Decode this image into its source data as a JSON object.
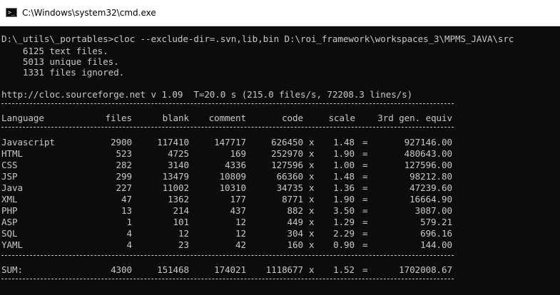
{
  "window": {
    "title": "C:\\Windows\\system32\\cmd.exe",
    "icon": "cmd-prompt-icon",
    "icon_glyph": ">_"
  },
  "console": {
    "command": "D:\\_utils\\_portables>cloc --exclude-dir=.svn,lib,bin D:\\roi_framework\\workspaces_3\\MPMS_JAVA\\src",
    "summary": [
      "    6125 text files.",
      "    5013 unique files.",
      "    1331 files ignored."
    ],
    "header_info": "http://cloc.sourceforge.net v 1.09  T=20.0 s (215.0 files/s, 72208.3 lines/s)",
    "columns": [
      "Language",
      "files",
      "blank",
      "comment",
      "code",
      "scale",
      "3rd gen. equiv"
    ],
    "rows": [
      {
        "language": "Javascript",
        "files": "2900",
        "blank": "117410",
        "comment": "147717",
        "code": "626450",
        "x": "x",
        "scale": "1.48",
        "eq": "=",
        "equiv": "927146.00"
      },
      {
        "language": "HTML",
        "files": "523",
        "blank": "4725",
        "comment": "169",
        "code": "252970",
        "x": "x",
        "scale": "1.90",
        "eq": "=",
        "equiv": "480643.00"
      },
      {
        "language": "CSS",
        "files": "282",
        "blank": "3140",
        "comment": "4336",
        "code": "127596",
        "x": "x",
        "scale": "1.00",
        "eq": "=",
        "equiv": "127596.00"
      },
      {
        "language": "JSP",
        "files": "299",
        "blank": "13479",
        "comment": "10809",
        "code": "66360",
        "x": "x",
        "scale": "1.48",
        "eq": "=",
        "equiv": "98212.80"
      },
      {
        "language": "Java",
        "files": "227",
        "blank": "11002",
        "comment": "10310",
        "code": "34735",
        "x": "x",
        "scale": "1.36",
        "eq": "=",
        "equiv": "47239.60"
      },
      {
        "language": "XML",
        "files": "47",
        "blank": "1362",
        "comment": "177",
        "code": "8771",
        "x": "x",
        "scale": "1.90",
        "eq": "=",
        "equiv": "16664.90"
      },
      {
        "language": "PHP",
        "files": "13",
        "blank": "214",
        "comment": "437",
        "code": "882",
        "x": "x",
        "scale": "3.50",
        "eq": "=",
        "equiv": "3087.00"
      },
      {
        "language": "ASP",
        "files": "1",
        "blank": "101",
        "comment": "12",
        "code": "449",
        "x": "x",
        "scale": "1.29",
        "eq": "=",
        "equiv": "579.21"
      },
      {
        "language": "SQL",
        "files": "4",
        "blank": "12",
        "comment": "12",
        "code": "304",
        "x": "x",
        "scale": "2.29",
        "eq": "=",
        "equiv": "696.16"
      },
      {
        "language": "YAML",
        "files": "4",
        "blank": "23",
        "comment": "42",
        "code": "160",
        "x": "x",
        "scale": "0.90",
        "eq": "=",
        "equiv": "144.00"
      }
    ],
    "sum": {
      "language": "SUM:",
      "files": "4300",
      "blank": "151468",
      "comment": "174021",
      "code": "1118677",
      "x": "x",
      "scale": "1.52",
      "eq": "=",
      "equiv": "1702008.67"
    }
  },
  "colors": {
    "console_bg": "#0c0c0c",
    "console_text": "#c8c8c8",
    "titlebar_bg": "#ffffff"
  }
}
